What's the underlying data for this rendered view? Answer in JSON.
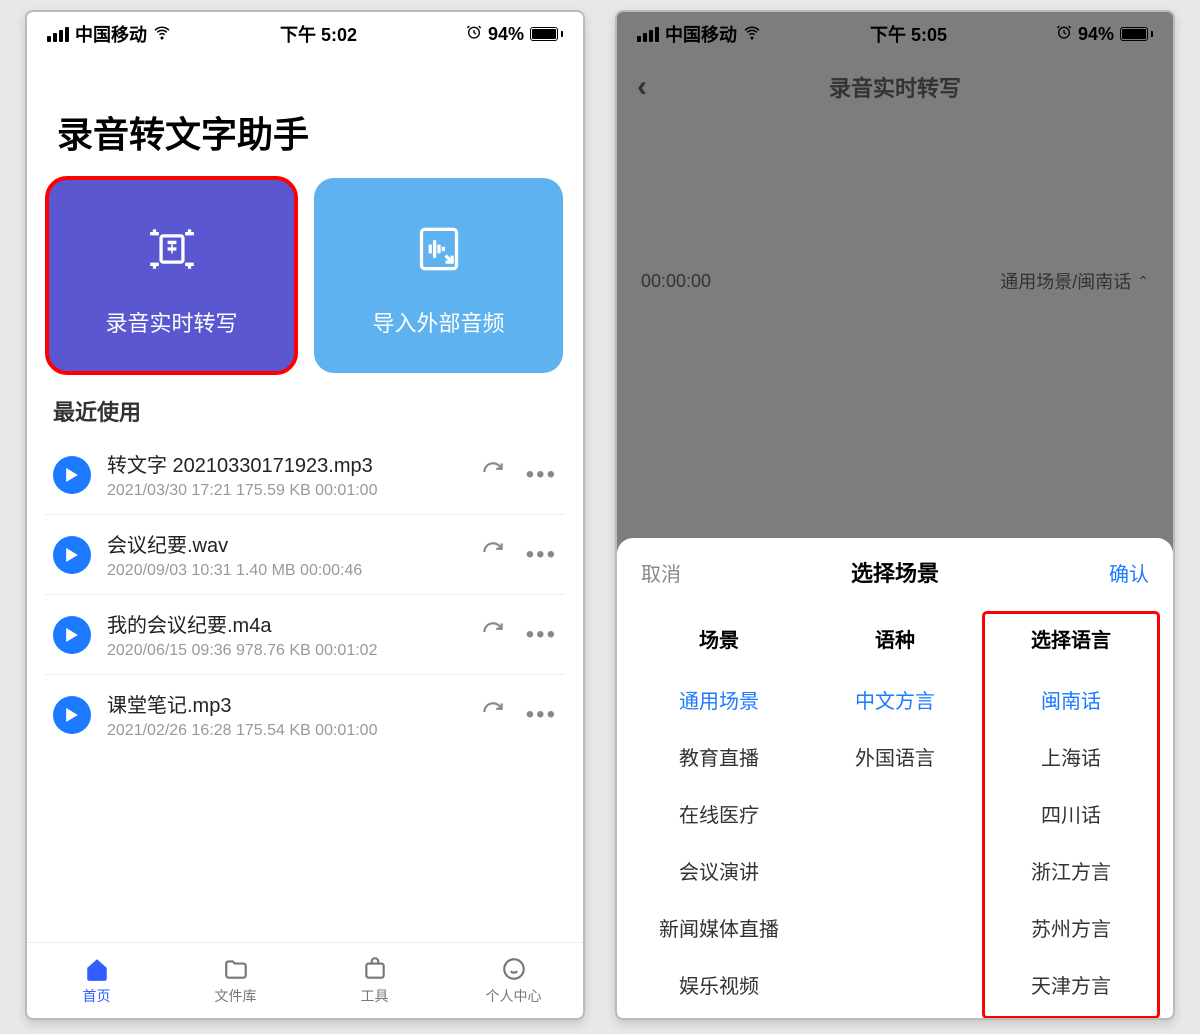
{
  "left": {
    "status": {
      "carrier": "中国移动",
      "time": "下午 5:02",
      "battery": "94%"
    },
    "title": "录音转文字助手",
    "cards": {
      "realtime": "录音实时转写",
      "import": "导入外部音频"
    },
    "recent_label": "最近使用",
    "files": [
      {
        "name": "转文字 20210330171923.mp3",
        "meta": "2021/03/30 17:21 175.59 KB  00:01:00"
      },
      {
        "name": "会议纪要.wav",
        "meta": "2020/09/03 10:31 1.40 MB  00:00:46"
      },
      {
        "name": "我的会议纪要.m4a",
        "meta": "2020/06/15 09:36 978.76 KB  00:01:02"
      },
      {
        "name": "课堂笔记.mp3",
        "meta": "2021/02/26 16:28 175.54 KB  00:01:00"
      }
    ],
    "tabs": [
      "首页",
      "文件库",
      "工具",
      "个人中心"
    ]
  },
  "right": {
    "status": {
      "carrier": "中国移动",
      "time": "下午 5:05",
      "battery": "94%"
    },
    "header": "录音实时转写",
    "timer": "00:00:00",
    "lang_selected": "通用场景/闽南话",
    "sheet": {
      "cancel": "取消",
      "title": "选择场景",
      "confirm": "确认",
      "cols": {
        "scene": {
          "header": "场景",
          "items": [
            "通用场景",
            "教育直播",
            "在线医疗",
            "会议演讲",
            "新闻媒体直播",
            "娱乐视频"
          ],
          "selected": 0
        },
        "langtype": {
          "header": "语种",
          "items": [
            "中文方言",
            "外国语言"
          ],
          "selected": 0
        },
        "dialect": {
          "header": "选择语言",
          "items": [
            "闽南话",
            "上海话",
            "四川话",
            "浙江方言",
            "苏州方言",
            "天津方言"
          ],
          "selected": 0
        }
      }
    }
  }
}
